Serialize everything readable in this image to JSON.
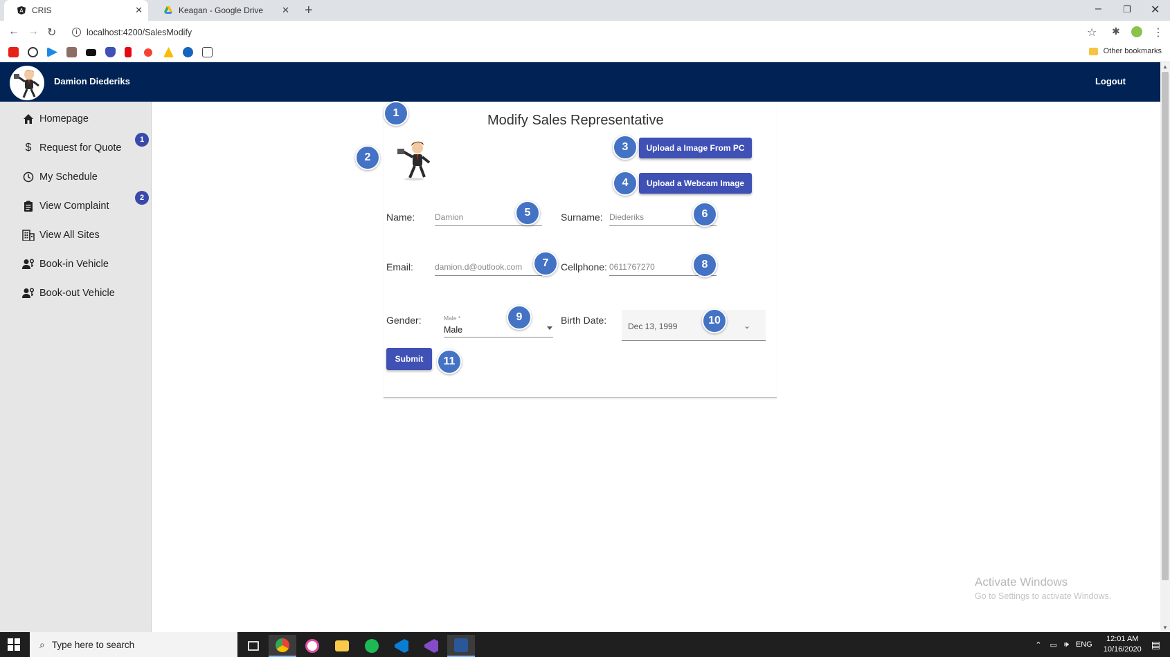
{
  "browser": {
    "tabs": [
      {
        "title": "CRIS"
      },
      {
        "title": "Keagan - Google Drive"
      }
    ],
    "url": "localhost:4200/SalesModify",
    "other_bookmarks": "Other bookmarks"
  },
  "header": {
    "user_name": "Damion Diederiks",
    "logout": "Logout"
  },
  "sidebar": {
    "items": [
      {
        "label": "Homepage",
        "icon": "home-icon"
      },
      {
        "label": "Request for Quote",
        "icon": "dollar-icon"
      },
      {
        "label": "My Schedule",
        "icon": "clock-icon"
      },
      {
        "label": "View Complaint",
        "icon": "clipboard-icon"
      },
      {
        "label": "View All Sites",
        "icon": "building-icon"
      },
      {
        "label": "Book-in Vehicle",
        "icon": "person-key-icon"
      },
      {
        "label": "Book-out Vehicle",
        "icon": "person-key-icon"
      }
    ],
    "badges": [
      "1",
      "2"
    ]
  },
  "form": {
    "title": "Modify Sales Representative",
    "upload_pc": "Upload a Image From PC",
    "upload_webcam": "Upload a Webcam Image",
    "name_label": "Name:",
    "name_value": "Damion",
    "surname_label": "Surname:",
    "surname_value": "Diederiks",
    "email_label": "Email:",
    "email_value": "damion.d@outlook.com",
    "cellphone_label": "Cellphone:",
    "cellphone_value": "0611767270",
    "gender_label": "Gender:",
    "gender_float_label": "Male *",
    "gender_value": "Male",
    "birth_label": "Birth Date:",
    "birth_value": "Dec 13, 1999",
    "submit": "Submit"
  },
  "markers": [
    "1",
    "2",
    "3",
    "4",
    "5",
    "6",
    "7",
    "8",
    "9",
    "10",
    "11"
  ],
  "watermark": {
    "line1": "Activate Windows",
    "line2": "Go to Settings to activate Windows."
  },
  "taskbar": {
    "search_placeholder": "Type here to search",
    "language": "ENG",
    "time": "12:01 AM",
    "date": "10/16/2020"
  },
  "colors": {
    "header": "#002254",
    "primary_button": "#3f51b5",
    "marker": "#4472c4",
    "sidebar": "#e6e6e6"
  }
}
